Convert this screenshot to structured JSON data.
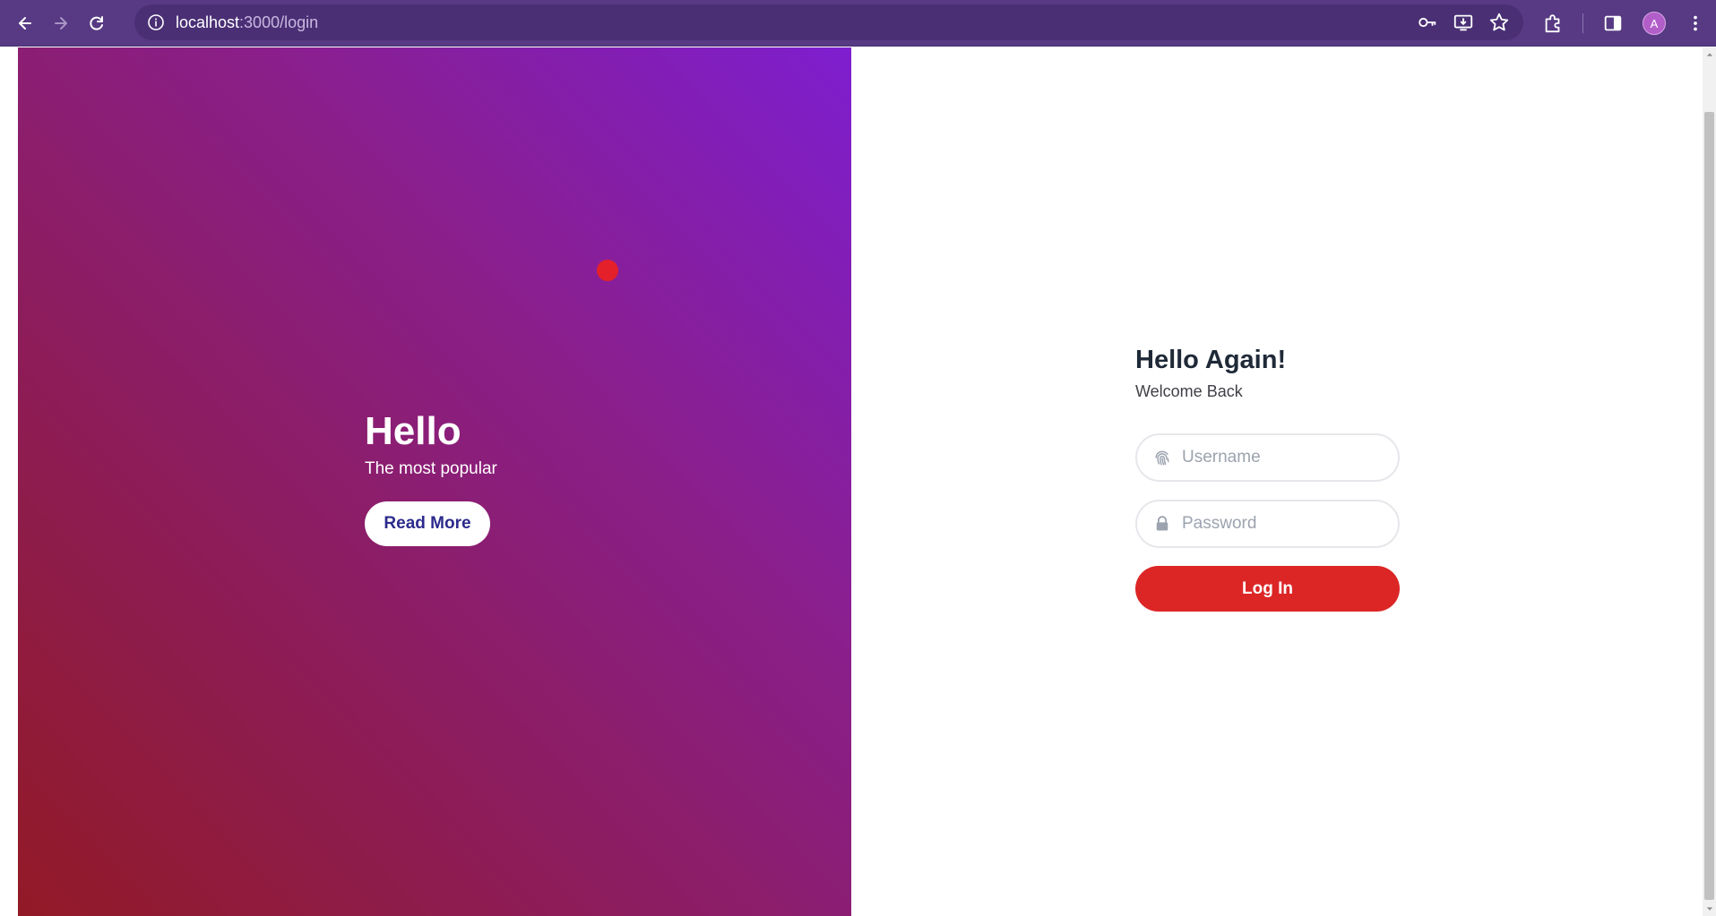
{
  "browser": {
    "url_host": "localhost",
    "url_path": ":3000/login",
    "avatar_letter": "A",
    "icons": [
      "back-icon",
      "forward-icon",
      "reload-icon",
      "site-info-icon",
      "password-key-icon",
      "install-app-icon",
      "bookmark-star-icon",
      "extensions-icon",
      "side-panel-icon",
      "menu-dots-icon"
    ],
    "theme_color": "#573a83"
  },
  "hero": {
    "title": "Hello",
    "subtitle": "The most popular",
    "button_label": "Read More",
    "gradient": [
      "#921a26",
      "#8c1d63",
      "#7e1ecf"
    ]
  },
  "login": {
    "title": "Hello Again!",
    "subtitle": "Welcome Back",
    "username_placeholder": "Username",
    "password_placeholder": "Password",
    "submit_label": "Log In",
    "accent_color": "#dc2626"
  }
}
